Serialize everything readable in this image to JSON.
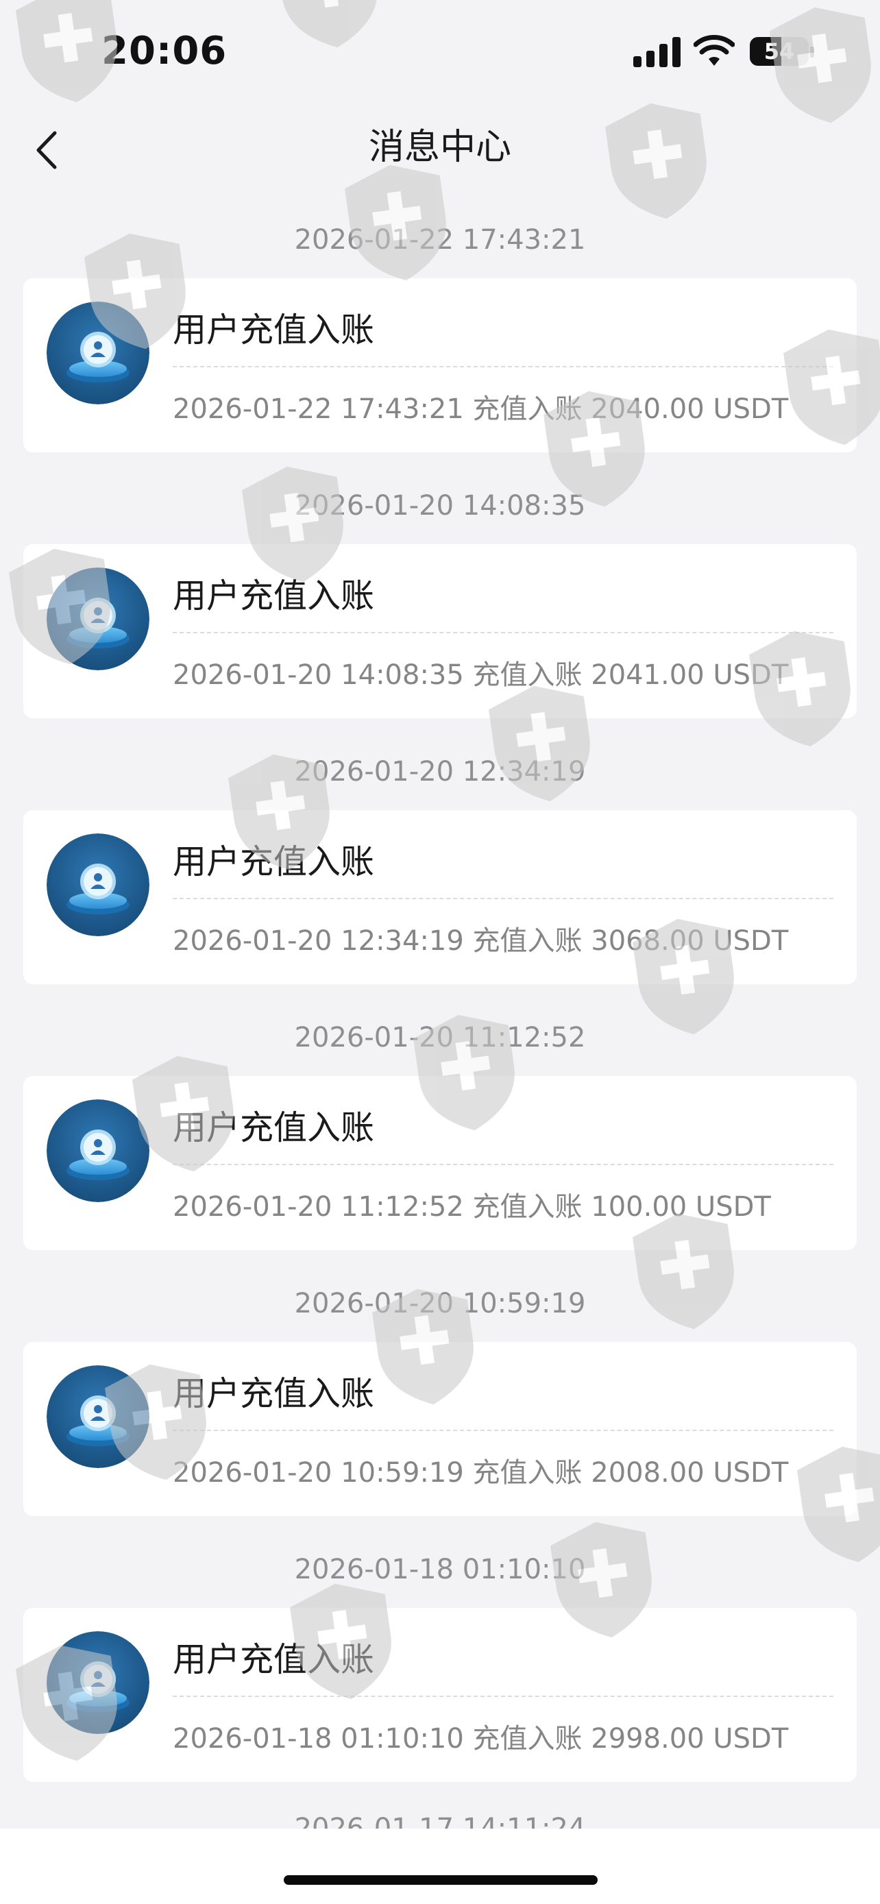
{
  "status_bar": {
    "time": "20:06",
    "battery": "54",
    "battery_level": 0.54
  },
  "nav": {
    "title": "消息中心",
    "back_icon": "chevron-left-icon"
  },
  "messages": [
    {
      "time": "2026-01-22 17:43:21",
      "title": "用户充值入账",
      "detail": "2026-01-22 17:43:21 充值入账 2040.00 USDT"
    },
    {
      "time": "2026-01-20 14:08:35",
      "title": "用户充值入账",
      "detail": "2026-01-20 14:08:35 充值入账 2041.00 USDT"
    },
    {
      "time": "2026-01-20 12:34:19",
      "title": "用户充值入账",
      "detail": "2026-01-20 12:34:19 充值入账 3068.00 USDT"
    },
    {
      "time": "2026-01-20 11:12:52",
      "title": "用户充值入账",
      "detail": "2026-01-20 11:12:52 充值入账 100.00 USDT"
    },
    {
      "time": "2026-01-20 10:59:19",
      "title": "用户充值入账",
      "detail": "2026-01-20 10:59:19 充值入账 2008.00 USDT"
    },
    {
      "time": "2026-01-18 01:10:10",
      "title": "用户充值入账",
      "detail": "2026-01-18 01:10:10 充值入账 2998.00 USDT"
    }
  ],
  "partial_next_time": "2026-01-17 14:11:24",
  "colors": {
    "background": "#f3f3f6",
    "card": "#ffffff",
    "avatar": "#1f5e93",
    "watermark": "#c8c8c8"
  }
}
